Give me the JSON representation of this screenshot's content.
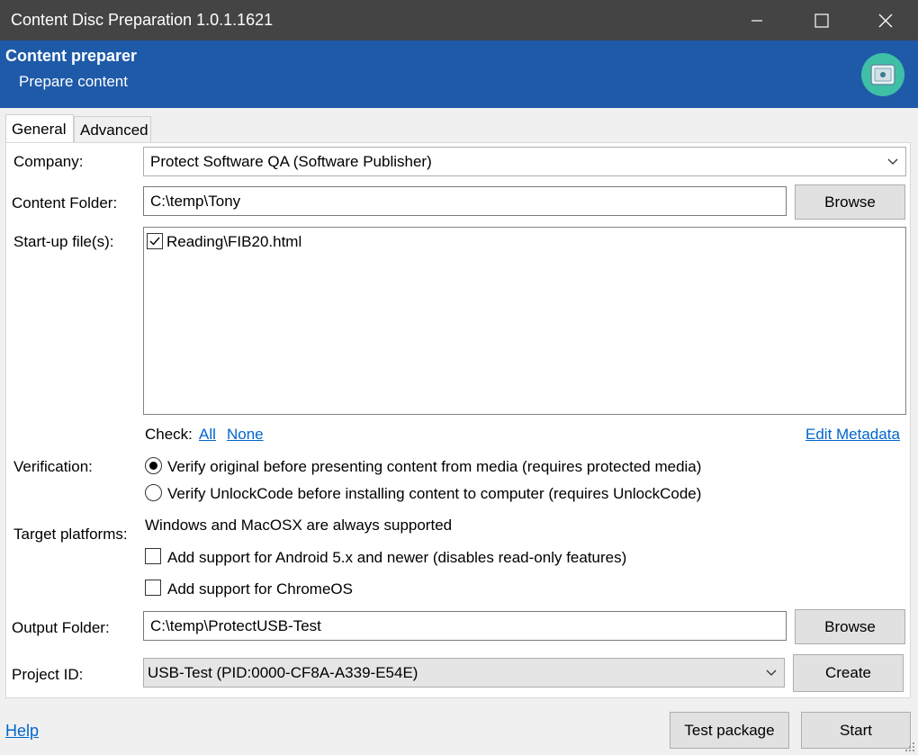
{
  "window": {
    "title": "Content Disc Preparation  1.0.1.1621"
  },
  "banner": {
    "title": "Content preparer",
    "subtitle": "Prepare content"
  },
  "tabs": [
    {
      "label": "General"
    },
    {
      "label": "Advanced"
    }
  ],
  "company": {
    "label": "Company:",
    "value": "Protect Software QA (Software Publisher)"
  },
  "content_folder": {
    "label": "Content Folder:",
    "value": "C:\\temp\\Tony",
    "browse_label": "Browse"
  },
  "startup": {
    "label": "Start-up file(s):",
    "files": [
      {
        "name": "Reading\\FIB20.html",
        "checked": true
      }
    ]
  },
  "check": {
    "label": "Check:",
    "all": "All",
    "none": "None",
    "edit_metadata": "Edit Metadata"
  },
  "verification": {
    "label": "Verification:",
    "options": [
      {
        "label": "Verify original before presenting content from media (requires protected media)",
        "selected": true
      },
      {
        "label": "Verify UnlockCode before installing content to computer (requires UnlockCode)",
        "selected": false
      }
    ]
  },
  "platforms": {
    "label": "Target platforms:",
    "note": "Windows and MacOSX are always supported",
    "options": [
      {
        "label": "Add support for Android 5.x and newer (disables read-only features)",
        "checked": false
      },
      {
        "label": "Add support for ChromeOS",
        "checked": false
      }
    ]
  },
  "output_folder": {
    "label": "Output Folder:",
    "value": "C:\\temp\\ProtectUSB-Test",
    "browse_label": "Browse"
  },
  "project": {
    "label": "Project ID:",
    "value": "USB-Test (PID:0000-CF8A-A339-E54E)",
    "create_label": "Create"
  },
  "footer": {
    "help": "Help",
    "test_package": "Test package",
    "start": "Start"
  },
  "colors": {
    "titlebar": "#444444",
    "banner": "#1e5aa8",
    "link": "#0066cc",
    "logo": "#3fbfa6"
  }
}
